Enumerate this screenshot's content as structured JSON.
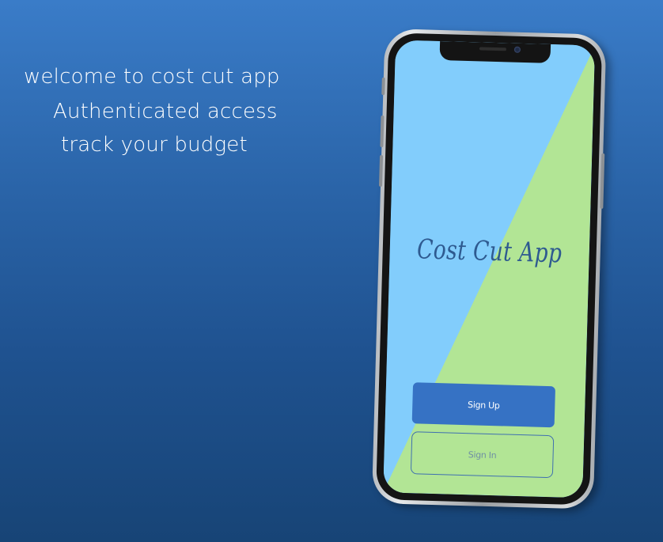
{
  "promo": {
    "line1": "welcome to cost cut app",
    "line2": "Authenticated access",
    "line3": "track your budget"
  },
  "app": {
    "title": "Cost Cut App",
    "signup_label": "Sign Up",
    "signin_label": "Sign In"
  },
  "colors": {
    "background_top": "#3a7cc8",
    "background_bottom": "#174476",
    "screen_blue": "#82cdfc",
    "screen_green": "#b2e595",
    "title_color": "#2e5a90",
    "primary_button": "#3672c4"
  }
}
